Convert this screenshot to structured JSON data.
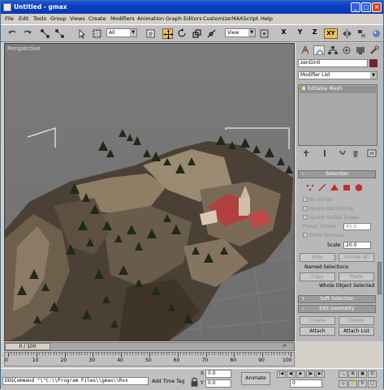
{
  "window": {
    "title": "Untitled - gmax",
    "app_icon": "gmax-app-icon"
  },
  "window_buttons": [
    "_",
    "□",
    "×"
  ],
  "menu": [
    "File",
    "Edit",
    "Tools",
    "Group",
    "Views",
    "Create",
    "Modifiers",
    "Animation",
    "Graph Editors",
    "Customize",
    "MAXScript",
    "Help"
  ],
  "toolbar": {
    "selection_filter": "All",
    "reference_coord": "View",
    "axis_constraint": "XY"
  },
  "viewport": {
    "label": "Perspective"
  },
  "command_panel": {
    "object_name": "zenGin0",
    "object_color": "#8a1a2a",
    "modifier_list": "Modifier List",
    "stack_item": "Editable Mesh",
    "rollouts": {
      "selection": {
        "title": "Selection",
        "by_vertex": "By Vertex",
        "ignore_backfacing": "Ignore Backfacing",
        "ignore_visible_edges": "Ignore Visible Edges",
        "planar_thresh_label": "Planar Thresh",
        "planar_thresh": "45.0",
        "show_normals": "Show Normals",
        "scale_label": "Scale",
        "scale": "20.0",
        "hide": "Hide",
        "unhide_all": "Unhide All",
        "named_selections": "Named Selections",
        "copy": "Copy",
        "paste": "Paste",
        "whole_object": "Whole Object Selected"
      },
      "soft_selection": {
        "sign": "+",
        "title": "Soft Selection"
      },
      "edit_geometry": {
        "sign": "−",
        "title": "Edit Geometry",
        "create": "Create",
        "delete": "Delete",
        "attach": "Attach",
        "attach_list": "Attach List",
        "break": "Break",
        "turn": "Turn",
        "extrude": "Extrude",
        "extrude_value": "0.0"
      }
    }
  },
  "timeline": {
    "frame_readout": "0 / 100",
    "ticks": [
      "0",
      "10",
      "20",
      "30",
      "40",
      "50",
      "60",
      "70",
      "80",
      "90",
      "100"
    ]
  },
  "status": {
    "maxscript": "DOSCommand \"\\\"C:\\\\Program Files\\\\gmax\\\\Rxx",
    "add_time_tag": "Add Time Tag",
    "x_label": "X",
    "x_value": "0.0",
    "y_label": "Y",
    "y_value": "0.0",
    "animate": "Animate",
    "current_frame": "0"
  }
}
